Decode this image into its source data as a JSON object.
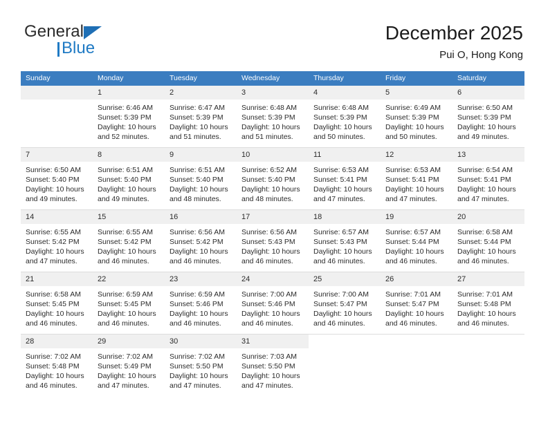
{
  "brand": {
    "word_general": "General",
    "word_blue": "Blue",
    "flag_icon": "blue-triangle-flag-icon"
  },
  "header": {
    "title": "December 2025",
    "subtitle": "Pui O, Hong Kong"
  },
  "colors": {
    "header_blue": "#3b7dc0",
    "brand_blue": "#1f7ac4",
    "daynum_bg": "#f0f0f0",
    "row_divider": "#dcdcdc",
    "text": "#2b2b2b"
  },
  "weekday_headers": [
    "Sunday",
    "Monday",
    "Tuesday",
    "Wednesday",
    "Thursday",
    "Friday",
    "Saturday"
  ],
  "weeks": [
    [
      {
        "day": "",
        "empty": true,
        "sunrise": "",
        "sunset": "",
        "daylight": ""
      },
      {
        "day": "1",
        "sunrise": "Sunrise: 6:46 AM",
        "sunset": "Sunset: 5:39 PM",
        "daylight": "Daylight: 10 hours and 52 minutes."
      },
      {
        "day": "2",
        "sunrise": "Sunrise: 6:47 AM",
        "sunset": "Sunset: 5:39 PM",
        "daylight": "Daylight: 10 hours and 51 minutes."
      },
      {
        "day": "3",
        "sunrise": "Sunrise: 6:48 AM",
        "sunset": "Sunset: 5:39 PM",
        "daylight": "Daylight: 10 hours and 51 minutes."
      },
      {
        "day": "4",
        "sunrise": "Sunrise: 6:48 AM",
        "sunset": "Sunset: 5:39 PM",
        "daylight": "Daylight: 10 hours and 50 minutes."
      },
      {
        "day": "5",
        "sunrise": "Sunrise: 6:49 AM",
        "sunset": "Sunset: 5:39 PM",
        "daylight": "Daylight: 10 hours and 50 minutes."
      },
      {
        "day": "6",
        "sunrise": "Sunrise: 6:50 AM",
        "sunset": "Sunset: 5:39 PM",
        "daylight": "Daylight: 10 hours and 49 minutes."
      }
    ],
    [
      {
        "day": "7",
        "sunrise": "Sunrise: 6:50 AM",
        "sunset": "Sunset: 5:40 PM",
        "daylight": "Daylight: 10 hours and 49 minutes."
      },
      {
        "day": "8",
        "sunrise": "Sunrise: 6:51 AM",
        "sunset": "Sunset: 5:40 PM",
        "daylight": "Daylight: 10 hours and 49 minutes."
      },
      {
        "day": "9",
        "sunrise": "Sunrise: 6:51 AM",
        "sunset": "Sunset: 5:40 PM",
        "daylight": "Daylight: 10 hours and 48 minutes."
      },
      {
        "day": "10",
        "sunrise": "Sunrise: 6:52 AM",
        "sunset": "Sunset: 5:40 PM",
        "daylight": "Daylight: 10 hours and 48 minutes."
      },
      {
        "day": "11",
        "sunrise": "Sunrise: 6:53 AM",
        "sunset": "Sunset: 5:41 PM",
        "daylight": "Daylight: 10 hours and 47 minutes."
      },
      {
        "day": "12",
        "sunrise": "Sunrise: 6:53 AM",
        "sunset": "Sunset: 5:41 PM",
        "daylight": "Daylight: 10 hours and 47 minutes."
      },
      {
        "day": "13",
        "sunrise": "Sunrise: 6:54 AM",
        "sunset": "Sunset: 5:41 PM",
        "daylight": "Daylight: 10 hours and 47 minutes."
      }
    ],
    [
      {
        "day": "14",
        "sunrise": "Sunrise: 6:55 AM",
        "sunset": "Sunset: 5:42 PM",
        "daylight": "Daylight: 10 hours and 47 minutes."
      },
      {
        "day": "15",
        "sunrise": "Sunrise: 6:55 AM",
        "sunset": "Sunset: 5:42 PM",
        "daylight": "Daylight: 10 hours and 46 minutes."
      },
      {
        "day": "16",
        "sunrise": "Sunrise: 6:56 AM",
        "sunset": "Sunset: 5:42 PM",
        "daylight": "Daylight: 10 hours and 46 minutes."
      },
      {
        "day": "17",
        "sunrise": "Sunrise: 6:56 AM",
        "sunset": "Sunset: 5:43 PM",
        "daylight": "Daylight: 10 hours and 46 minutes."
      },
      {
        "day": "18",
        "sunrise": "Sunrise: 6:57 AM",
        "sunset": "Sunset: 5:43 PM",
        "daylight": "Daylight: 10 hours and 46 minutes."
      },
      {
        "day": "19",
        "sunrise": "Sunrise: 6:57 AM",
        "sunset": "Sunset: 5:44 PM",
        "daylight": "Daylight: 10 hours and 46 minutes."
      },
      {
        "day": "20",
        "sunrise": "Sunrise: 6:58 AM",
        "sunset": "Sunset: 5:44 PM",
        "daylight": "Daylight: 10 hours and 46 minutes."
      }
    ],
    [
      {
        "day": "21",
        "sunrise": "Sunrise: 6:58 AM",
        "sunset": "Sunset: 5:45 PM",
        "daylight": "Daylight: 10 hours and 46 minutes."
      },
      {
        "day": "22",
        "sunrise": "Sunrise: 6:59 AM",
        "sunset": "Sunset: 5:45 PM",
        "daylight": "Daylight: 10 hours and 46 minutes."
      },
      {
        "day": "23",
        "sunrise": "Sunrise: 6:59 AM",
        "sunset": "Sunset: 5:46 PM",
        "daylight": "Daylight: 10 hours and 46 minutes."
      },
      {
        "day": "24",
        "sunrise": "Sunrise: 7:00 AM",
        "sunset": "Sunset: 5:46 PM",
        "daylight": "Daylight: 10 hours and 46 minutes."
      },
      {
        "day": "25",
        "sunrise": "Sunrise: 7:00 AM",
        "sunset": "Sunset: 5:47 PM",
        "daylight": "Daylight: 10 hours and 46 minutes."
      },
      {
        "day": "26",
        "sunrise": "Sunrise: 7:01 AM",
        "sunset": "Sunset: 5:47 PM",
        "daylight": "Daylight: 10 hours and 46 minutes."
      },
      {
        "day": "27",
        "sunrise": "Sunrise: 7:01 AM",
        "sunset": "Sunset: 5:48 PM",
        "daylight": "Daylight: 10 hours and 46 minutes."
      }
    ],
    [
      {
        "day": "28",
        "sunrise": "Sunrise: 7:02 AM",
        "sunset": "Sunset: 5:48 PM",
        "daylight": "Daylight: 10 hours and 46 minutes."
      },
      {
        "day": "29",
        "sunrise": "Sunrise: 7:02 AM",
        "sunset": "Sunset: 5:49 PM",
        "daylight": "Daylight: 10 hours and 47 minutes."
      },
      {
        "day": "30",
        "sunrise": "Sunrise: 7:02 AM",
        "sunset": "Sunset: 5:50 PM",
        "daylight": "Daylight: 10 hours and 47 minutes."
      },
      {
        "day": "31",
        "sunrise": "Sunrise: 7:03 AM",
        "sunset": "Sunset: 5:50 PM",
        "daylight": "Daylight: 10 hours and 47 minutes."
      },
      {
        "day": "",
        "blank": true,
        "sunrise": "",
        "sunset": "",
        "daylight": ""
      },
      {
        "day": "",
        "blank": true,
        "sunrise": "",
        "sunset": "",
        "daylight": ""
      },
      {
        "day": "",
        "blank": true,
        "sunrise": "",
        "sunset": "",
        "daylight": ""
      }
    ]
  ]
}
